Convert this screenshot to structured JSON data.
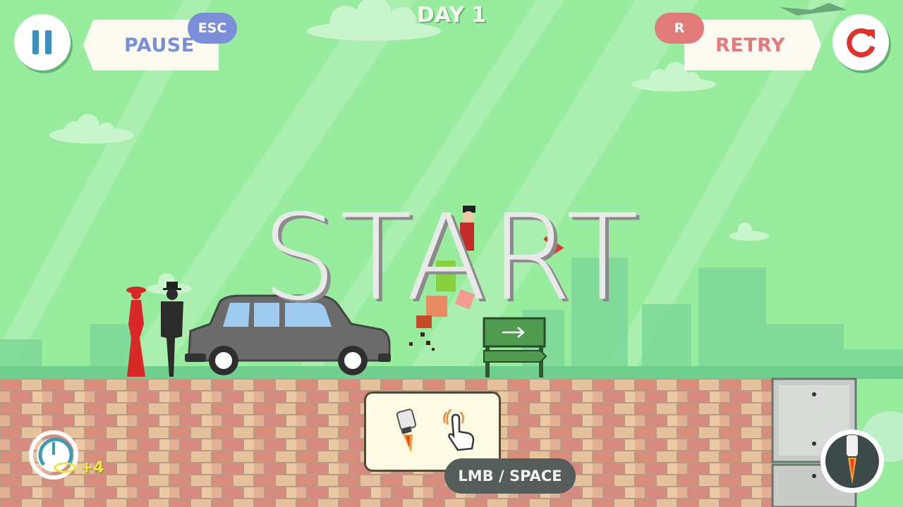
{
  "hud": {
    "pause_label": "PAUSE",
    "pause_key": "ESC",
    "retry_label": "RETRY",
    "retry_key": "R",
    "day_title": "DAY 1"
  },
  "center": {
    "start_text": "START"
  },
  "controls_hint": {
    "key_label": "LMB / SPACE",
    "icons": [
      "rocket-boost-icon",
      "tap-hand-icon"
    ]
  },
  "speedometer": {
    "bonus": "+4"
  },
  "colors": {
    "sky": "#98ec9e",
    "pause_blue": "#7b8fd8",
    "retry_red": "#e27c7c",
    "brick": "#d99a86"
  }
}
